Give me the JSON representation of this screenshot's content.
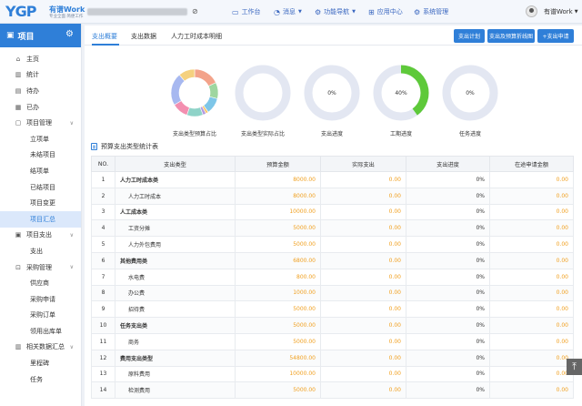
{
  "header": {
    "brand_logo": "YGP",
    "brand_name": "有谱Work",
    "brand_slogan": "专业全面 简便工作",
    "nav": [
      {
        "label": "工作台",
        "icon": "desktop-icon"
      },
      {
        "label": "消息",
        "icon": "bell-icon"
      },
      {
        "label": "功能导航",
        "icon": "link-icon"
      },
      {
        "label": "应用中心",
        "icon": "grid-icon"
      },
      {
        "label": "系统管理",
        "icon": "gear-icon"
      }
    ],
    "user_name": "有谱Work"
  },
  "sidebar": {
    "title": "项目",
    "items": [
      {
        "label": "主页",
        "icon": "home-icon"
      },
      {
        "label": "统计",
        "icon": "chart-icon"
      },
      {
        "label": "待办",
        "icon": "list-icon"
      },
      {
        "label": "已办",
        "icon": "done-icon"
      },
      {
        "label": "项目管理",
        "icon": "folder-icon"
      },
      {
        "label": "立项单"
      },
      {
        "label": "未结项目"
      },
      {
        "label": "结项单"
      },
      {
        "label": "已结项目"
      },
      {
        "label": "项目变更"
      },
      {
        "label": "项目汇总"
      },
      {
        "label": "项目支出",
        "icon": "wallet-icon"
      },
      {
        "label": "支出"
      },
      {
        "label": "采购管理",
        "icon": "cart-icon"
      },
      {
        "label": "供应商"
      },
      {
        "label": "采购申请"
      },
      {
        "label": "采购订单"
      },
      {
        "label": "领用出库单"
      },
      {
        "label": "相关数据汇总",
        "icon": "database-icon"
      },
      {
        "label": "里程碑"
      },
      {
        "label": "任务"
      }
    ]
  },
  "tabs": [
    "支出概要",
    "支出数据",
    "人力工时成本明细"
  ],
  "buttons": [
    "支出计划",
    "支出及预算折线图",
    "+支出申请"
  ],
  "donuts": [
    {
      "label": "支出类型预算占比",
      "center": ""
    },
    {
      "label": "支出类型实际占比",
      "center": ""
    },
    {
      "label": "支出进度",
      "center": "0%",
      "progress": 0
    },
    {
      "label": "工期进度",
      "center": "40%",
      "progress": 0.4
    },
    {
      "label": "任务进度",
      "center": "0%",
      "progress": 0
    }
  ],
  "colors": {
    "accent": "#2f7fd8",
    "amount": "#f0a020",
    "progress": "#5ec93a",
    "ring": "#e3e7f2"
  },
  "table": {
    "title": "预算支出类型统计表",
    "headers": [
      "NO.",
      "支出类型",
      "预算金额",
      "实际支出",
      "支出进度",
      "在途申请金额"
    ],
    "rows": [
      [
        "1",
        "人力工时成本类",
        "8000.00",
        "0.00",
        "0%",
        "0.00"
      ],
      [
        "2",
        "人力工时成本",
        "8000.00",
        "0.00",
        "0%",
        "0.00"
      ],
      [
        "3",
        "人工成本类",
        "10000.00",
        "0.00",
        "0%",
        "0.00"
      ],
      [
        "4",
        "工资分摊",
        "5000.00",
        "0.00",
        "0%",
        "0.00"
      ],
      [
        "5",
        "人力外包费用",
        "5000.00",
        "0.00",
        "0%",
        "0.00"
      ],
      [
        "6",
        "其他费用类",
        "6800.00",
        "0.00",
        "0%",
        "0.00"
      ],
      [
        "7",
        "水电费",
        "800.00",
        "0.00",
        "0%",
        "0.00"
      ],
      [
        "8",
        "办公费",
        "1000.00",
        "0.00",
        "0%",
        "0.00"
      ],
      [
        "9",
        "招待费",
        "5000.00",
        "0.00",
        "0%",
        "0.00"
      ],
      [
        "10",
        "任务支出类",
        "5000.00",
        "0.00",
        "0%",
        "0.00"
      ],
      [
        "11",
        "商务",
        "5000.00",
        "0.00",
        "0%",
        "0.00"
      ],
      [
        "12",
        "费用支出类型",
        "54800.00",
        "0.00",
        "0%",
        "0.00"
      ],
      [
        "13",
        "原料费用",
        "10000.00",
        "0.00",
        "0%",
        "0.00"
      ],
      [
        "14",
        "检测费用",
        "5000.00",
        "0.00",
        "0%",
        "0.00"
      ]
    ],
    "parent_rows": [
      0,
      2,
      5,
      9,
      11
    ]
  }
}
